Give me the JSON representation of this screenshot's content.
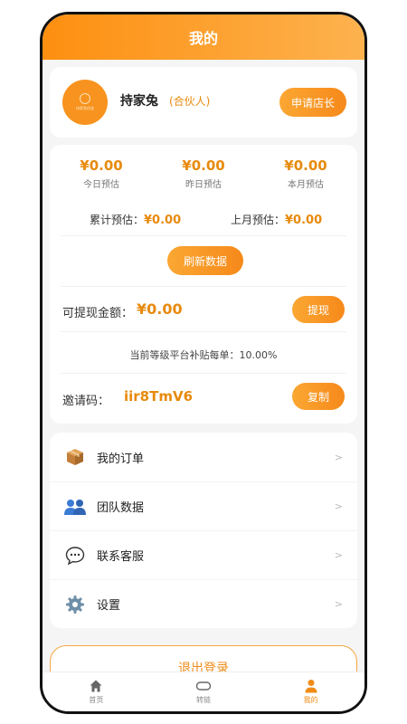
{
  "header": {
    "title": "我的"
  },
  "profile": {
    "avatar_text": "持家兔优选",
    "name": "持家兔",
    "role": "(合伙人)",
    "apply_button": "申请店长"
  },
  "earnings": {
    "stats": [
      {
        "value": "¥0.00",
        "label": "今日预估"
      },
      {
        "value": "¥0.00",
        "label": "昨日预估"
      },
      {
        "value": "¥0.00",
        "label": "本月预估"
      }
    ],
    "total_label": "累计预估：",
    "total_value": "¥0.00",
    "last_month_label": "上月预估：",
    "last_month_value": "¥0.00",
    "refresh_button": "刷新数据",
    "withdraw_label": "可提现金额：",
    "withdraw_value": "¥0.00",
    "withdraw_button": "提现",
    "subsidy_text": "当前等级平台补贴每单：10.00%",
    "invite_label": "邀请码：",
    "invite_code": "iir8TmV6",
    "copy_button": "复制"
  },
  "menu": [
    {
      "icon": "package-icon",
      "label": "我的订单",
      "arrow": ">"
    },
    {
      "icon": "team-icon",
      "label": "团队数据",
      "arrow": ">"
    },
    {
      "icon": "chat-bubble-icon",
      "label": "联系客服",
      "arrow": ">"
    },
    {
      "icon": "gear-icon",
      "label": "设置",
      "arrow": ">"
    }
  ],
  "logout_button": "退出登录",
  "tabbar": [
    {
      "icon": "home-icon",
      "label": "首页",
      "active": false
    },
    {
      "icon": "link-icon",
      "label": "转链",
      "active": false
    },
    {
      "icon": "user-icon",
      "label": "我的",
      "active": true
    }
  ],
  "colors": {
    "accent": "#f7931e",
    "accent_text": "#e88a0e",
    "background": "#f5f5f5"
  }
}
